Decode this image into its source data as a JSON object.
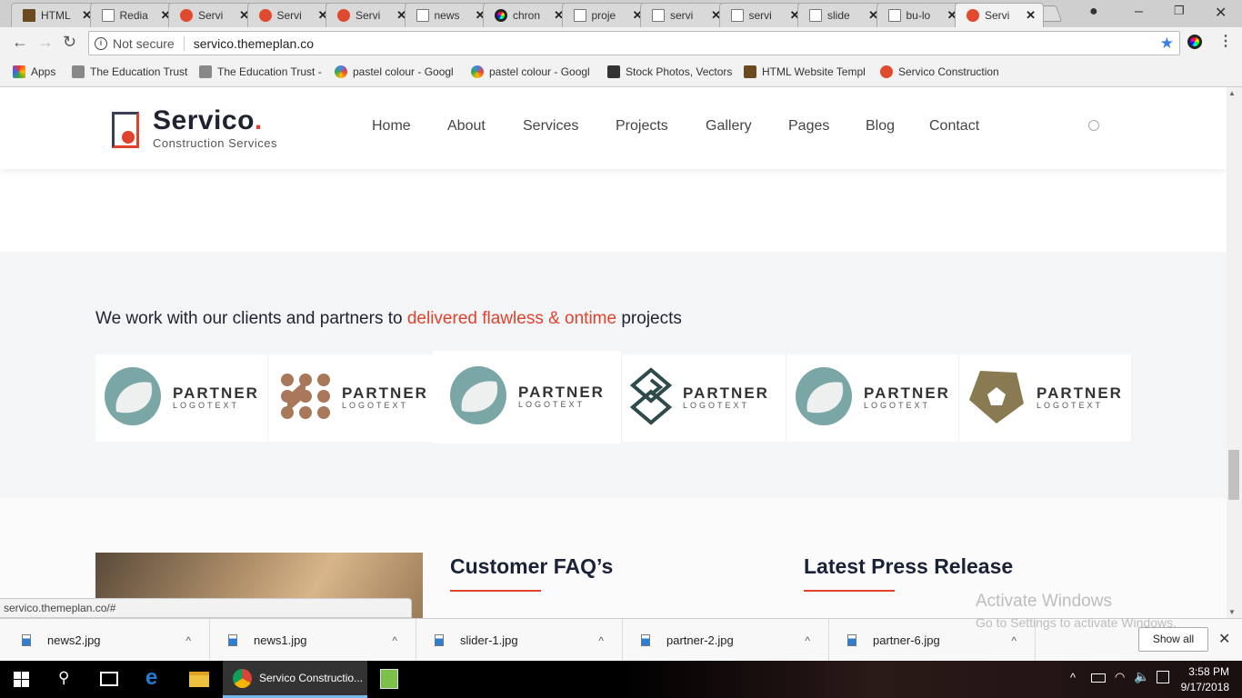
{
  "browser": {
    "tabs": [
      {
        "title": "HTML",
        "icon": "image"
      },
      {
        "title": "Redia",
        "icon": "doc"
      },
      {
        "title": "Servi",
        "icon": "servico"
      },
      {
        "title": "Servi",
        "icon": "servico"
      },
      {
        "title": "Servi",
        "icon": "servico"
      },
      {
        "title": "news",
        "icon": "doc"
      },
      {
        "title": "chron",
        "icon": "chrome"
      },
      {
        "title": "proje",
        "icon": "doc"
      },
      {
        "title": "servi",
        "icon": "doc"
      },
      {
        "title": "servi",
        "icon": "doc"
      },
      {
        "title": "slide",
        "icon": "doc"
      },
      {
        "title": "bu-lo",
        "icon": "doc"
      },
      {
        "title": "Servi",
        "icon": "servico",
        "active": true
      }
    ],
    "security": "Not secure",
    "url": "servico.themeplan.co",
    "bookmarks": [
      "Apps",
      "The Education Trust",
      "The Education Trust -",
      "pastel colour - Googl",
      "pastel colour - Googl",
      "Stock Photos, Vectors",
      "HTML Website Templ",
      "Servico Construction"
    ],
    "status_url": "servico.themeplan.co/#"
  },
  "site": {
    "brand": "Servico",
    "brand_dot": ".",
    "tagline": "Construction Services",
    "nav": [
      "Home",
      "About",
      "Services",
      "Projects",
      "Gallery",
      "Pages",
      "Blog",
      "Contact"
    ],
    "accent": "#e2412b",
    "partners_heading": {
      "before": "We work with our clients and partners to ",
      "highlight": "delivered flawless & ontime",
      "after": " projects"
    },
    "partners": [
      {
        "name": "PARTNER",
        "sub": "LOGOTEXT",
        "logo": "teal-ring"
      },
      {
        "name": "PARTNER",
        "sub": "LOGOTEXT",
        "logo": "brown-dots"
      },
      {
        "name": "PARTNER",
        "sub": "LOGOTEXT",
        "logo": "teal-ring"
      },
      {
        "name": "PARTNER",
        "sub": "LOGOTEXT",
        "logo": "diamond-lines"
      },
      {
        "name": "PARTNER",
        "sub": "LOGOTEXT",
        "logo": "teal-ring"
      },
      {
        "name": "PARTNER",
        "sub": "LOGOTEXT",
        "logo": "olive-pentagon"
      }
    ],
    "faq_title": "Customer FAQ’s",
    "press_title": "Latest Press Release"
  },
  "downloads": {
    "files": [
      "news2.jpg",
      "news1.jpg",
      "slider-1.jpg",
      "partner-2.jpg",
      "partner-6.jpg"
    ],
    "show_all": "Show all"
  },
  "watermark": {
    "title": "Activate Windows",
    "sub": "Go to Settings to activate Windows."
  },
  "taskbar": {
    "app_label": "Servico Constructio...",
    "time": "3:58 PM",
    "date": "9/17/2018"
  }
}
